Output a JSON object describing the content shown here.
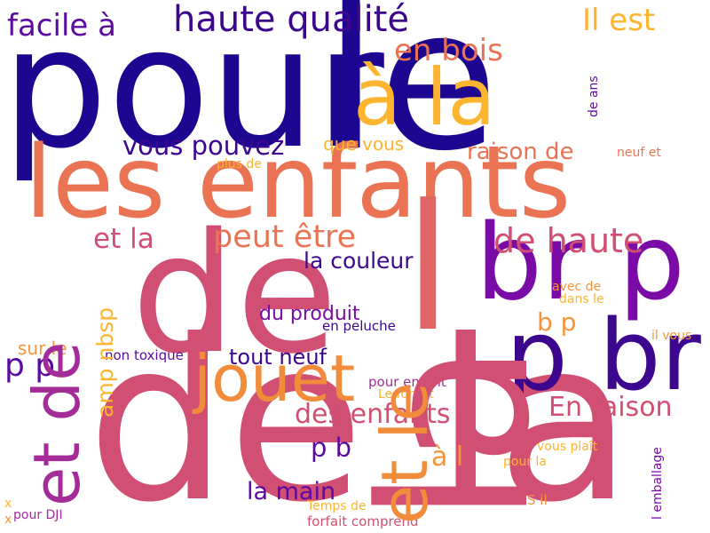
{
  "cloud": {
    "background": "#ffffff",
    "palette": [
      "#1e0790",
      "#3d068f",
      "#7a0ba6",
      "#a42c98",
      "#d04f73",
      "#ea7353",
      "#f7943b",
      "#fdb42f"
    ],
    "words": [
      {
        "text": "pour",
        "color": "#1e0790"
      },
      {
        "text": "le",
        "color": "#1e0790"
      },
      {
        "text": "les enfants",
        "color": "#ea7353"
      },
      {
        "text": "de",
        "color": "#d04f73"
      },
      {
        "text": "de la",
        "color": "#d04f73"
      },
      {
        "text": "la",
        "color": "#d04f73"
      },
      {
        "text": "l",
        "color": "#e06666"
      },
      {
        "text": "br p",
        "color": "#7a0ba6"
      },
      {
        "text": "p br",
        "color": "#3d068f"
      },
      {
        "text": "à la",
        "color": "#fdb42f"
      },
      {
        "text": "jouet",
        "color": "#f08c3a"
      },
      {
        "text": "haute qualité",
        "color": "#3d068f"
      },
      {
        "text": "facile à",
        "color": "#5c0aa0"
      },
      {
        "text": "Il est",
        "color": "#fdb42f"
      },
      {
        "text": "en bois",
        "color": "#ea7353"
      },
      {
        "text": "vous pouvez",
        "color": "#3d068f"
      },
      {
        "text": "que vous",
        "color": "#fdb42f"
      },
      {
        "text": "raison de",
        "color": "#ea7353"
      },
      {
        "text": "de haute",
        "color": "#d04f73"
      },
      {
        "text": "et la",
        "color": "#d04f73"
      },
      {
        "text": "peut être",
        "color": "#ea7353"
      },
      {
        "text": "la couleur",
        "color": "#3d068f"
      },
      {
        "text": "du produit",
        "color": "#7a0ba6"
      },
      {
        "text": "b p",
        "color": "#f7943b"
      },
      {
        "text": "tout neuf",
        "color": "#3d068f"
      },
      {
        "text": "des enfants",
        "color": "#d04f73"
      },
      {
        "text": "En raison",
        "color": "#d04f73"
      },
      {
        "text": "p b",
        "color": "#5c0aa0"
      },
      {
        "text": "à l",
        "color": "#f7943b"
      },
      {
        "text": "la main",
        "color": "#5c0aa0"
      },
      {
        "text": "p p",
        "color": "#5c0aa0"
      },
      {
        "text": "sur le",
        "color": "#f7943b"
      },
      {
        "text": "non toxique",
        "color": "#5c0aa0"
      },
      {
        "text": "en peluche",
        "color": "#3d068f"
      },
      {
        "text": "plus de",
        "color": "#fdb42f"
      },
      {
        "text": "neuf et",
        "color": "#ea7353"
      },
      {
        "text": "de ans",
        "color": "#5c0aa0"
      },
      {
        "text": "avec de",
        "color": "#f7943b"
      },
      {
        "text": "dans le",
        "color": "#fdb42f"
      },
      {
        "text": "il vous",
        "color": "#f7943b"
      },
      {
        "text": "pour enfant",
        "color": "#a42c98"
      },
      {
        "text": "Le forfait",
        "color": "#fdb42f"
      },
      {
        "text": "vous plaît",
        "color": "#fdb42f"
      },
      {
        "text": "pour la",
        "color": "#fdb42f"
      },
      {
        "text": "S il",
        "color": "#f7943b"
      },
      {
        "text": "Temps de",
        "color": "#fdb42f"
      },
      {
        "text": "forfait comprend",
        "color": "#d04f73"
      },
      {
        "text": "pour DJI",
        "color": "#a42c98"
      },
      {
        "text": "x",
        "color": "#fdb42f"
      },
      {
        "text": "x",
        "color": "#f7943b"
      },
      {
        "text": "et de",
        "color": "#a42c98"
      },
      {
        "text": "et le",
        "color": "#f08c3a"
      },
      {
        "text": "amp nbsp",
        "color": "#fdb42f"
      },
      {
        "text": "l emballage",
        "color": "#7a0ba6"
      }
    ]
  }
}
